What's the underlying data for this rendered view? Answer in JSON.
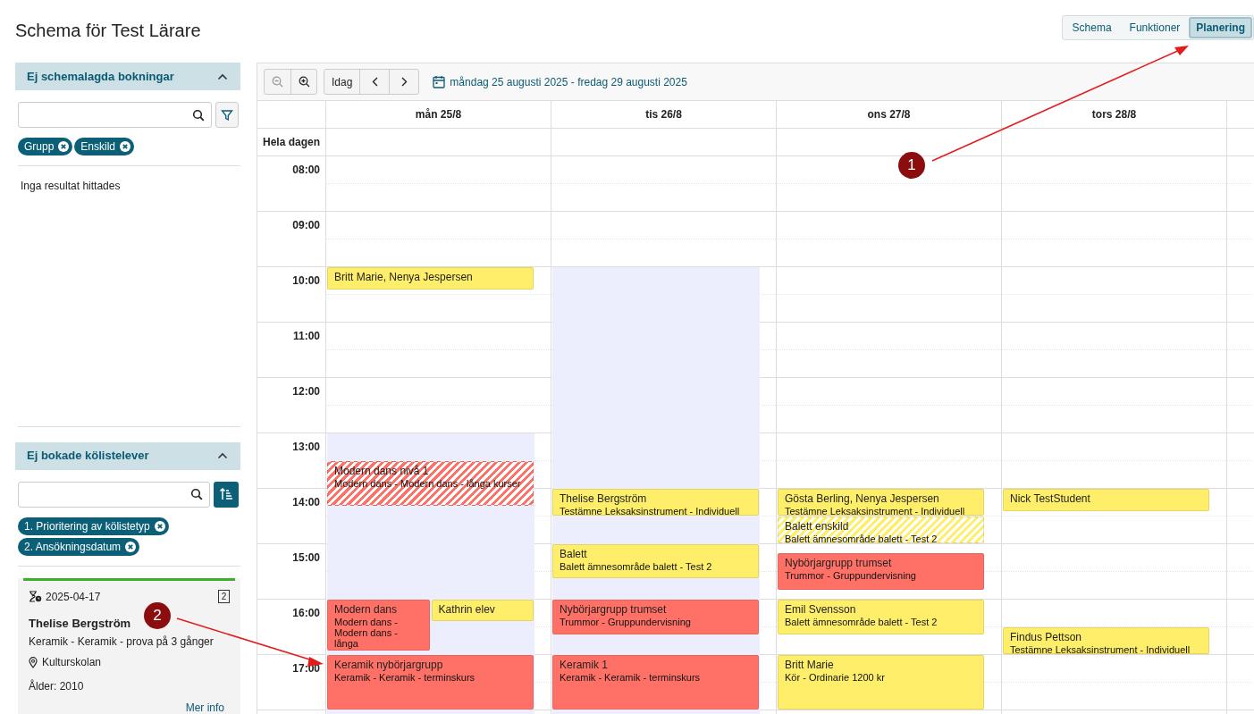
{
  "title": "Schema för Test Lärare",
  "view_tabs": [
    {
      "label": "Schema",
      "selected": false
    },
    {
      "label": "Funktioner",
      "selected": false
    },
    {
      "label": "Planering",
      "selected": true
    }
  ],
  "unscheduled": {
    "heading": "Ej schemalagda bokningar",
    "expanded": true,
    "chips": [
      "Grupp",
      "Enskild"
    ],
    "empty_text": "Inga resultat hittades"
  },
  "queue": {
    "heading": "Ej bokade kölistelever",
    "expanded": true,
    "chips": [
      "1. Prioritering av kölistetyp",
      "2. Ansökningsdatum"
    ],
    "cards": [
      {
        "date": "2025-04-17",
        "count": "2",
        "name": "Thelise Bergström",
        "course": "Keramik - Keramik - prova på 3 gånger",
        "place": "Kulturskolan",
        "age": "Ålder: 2010",
        "link": "Mer info",
        "color": "#3cb02c"
      }
    ]
  },
  "toolbar": {
    "today": "Idag",
    "range": "måndag 25 augusti 2025 - fredag 29 augusti 2025"
  },
  "calendar": {
    "all_day_label": "Hela dagen",
    "hours": [
      "08:00",
      "09:00",
      "10:00",
      "11:00",
      "12:00",
      "13:00",
      "14:00",
      "15:00",
      "16:00",
      "17:00"
    ],
    "days": [
      {
        "label": "mån 25/8",
        "working_hours": true,
        "events": [
          {
            "title": "Britt Marie, Nenya Jespersen",
            "color": "#ffee6a",
            "tentative": false
          },
          {
            "title": "Modern dans nivå 1",
            "subtitle": "Modern dans - Modern dans - långa kurser",
            "color": "#ff7066",
            "tentative": true
          },
          {
            "title": "Modern dans",
            "subtitle": "Modern dans - Modern dans - långa",
            "color": "#ff7066",
            "tentative": false
          },
          {
            "title": "Kathrin elev",
            "color": "#ffee6a",
            "tentative": false
          },
          {
            "title": "Keramik nybörjargrupp",
            "subtitle": "Keramik - Keramik - terminskurs",
            "color": "#ff7066",
            "tentative": false
          }
        ]
      },
      {
        "label": "tis 26/8",
        "working_hours": true,
        "events": [
          {
            "title": "Thelise Bergström",
            "subtitle": "Testämne Leksaksinstrument - Individuell",
            "color": "#ffee6a",
            "tentative": false
          },
          {
            "title": "Balett",
            "subtitle": "Balett ämnesområde balett - Test 2",
            "color": "#ffee6a",
            "tentative": false
          },
          {
            "title": "Nybörjargrupp trumset",
            "subtitle": "Trummor - Gruppundervisning",
            "color": "#ff7066",
            "tentative": false
          },
          {
            "title": "Keramik 1",
            "subtitle": "Keramik - Keramik - terminskurs",
            "color": "#ff7066",
            "tentative": false
          }
        ]
      },
      {
        "label": "ons 27/8",
        "working_hours": false,
        "events": [
          {
            "title": "Gösta Berling, Nenya Jespersen",
            "subtitle": "Testämne Leksaksinstrument - Individuell",
            "color": "#ffee6a",
            "tentative": false
          },
          {
            "title": "Balett enskild",
            "subtitle": "Balett ämnesområde balett - Test 2",
            "color": "#ffee6a",
            "tentative": true
          },
          {
            "title": "Nybörjargrupp trumset",
            "subtitle": "Trummor - Gruppundervisning",
            "color": "#ff7066",
            "tentative": false
          },
          {
            "title": "Emil Svensson",
            "subtitle": "Balett ämnesområde balett - Test 2",
            "color": "#ffee6a",
            "tentative": false
          },
          {
            "title": "Britt Marie",
            "subtitle": "Kör - Ordinarie 1200 kr",
            "color": "#ffee6a",
            "tentative": false
          }
        ]
      },
      {
        "label": "tors 28/8",
        "working_hours": false,
        "events": [
          {
            "title": "Nick TestStudent",
            "color": "#ffee6a",
            "tentative": false
          },
          {
            "title": "Findus Pettson",
            "subtitle": "Testämne Leksaksinstrument - Individuell",
            "color": "#ffee6a",
            "tentative": false
          }
        ]
      },
      {
        "working_hours": false
      }
    ]
  },
  "annotations": [
    {
      "label": "1"
    },
    {
      "label": "2"
    }
  ]
}
